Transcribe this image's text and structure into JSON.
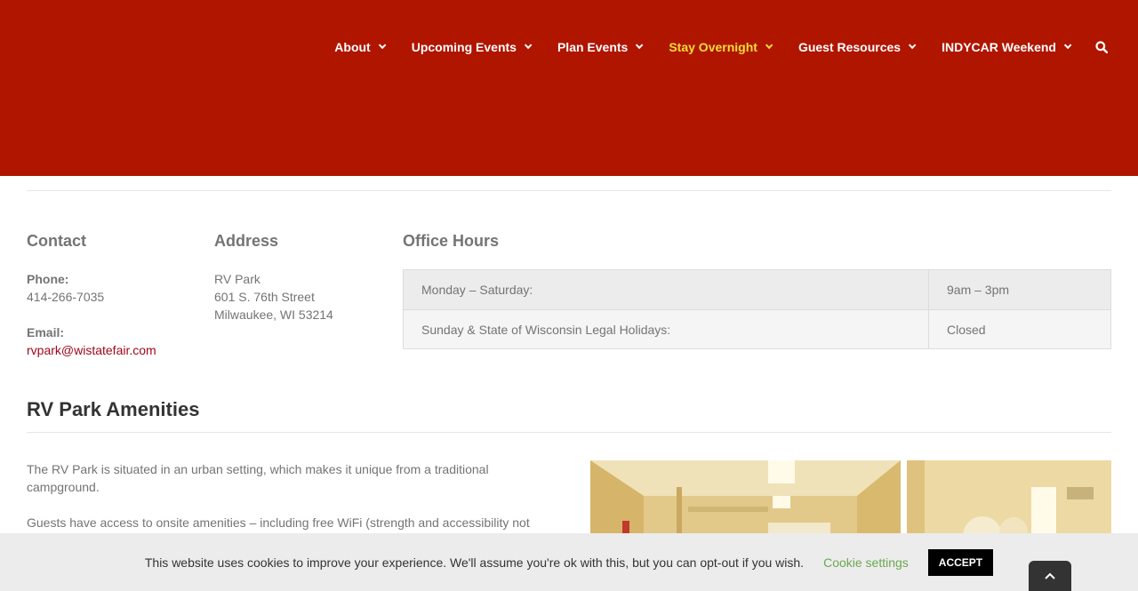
{
  "nav": {
    "items": [
      {
        "label": "About",
        "icon": "chevron-down-icon"
      },
      {
        "label": "Upcoming Events",
        "icon": "chevron-down-icon"
      },
      {
        "label": "Plan Events",
        "icon": "chevron-down-icon"
      },
      {
        "label": "Stay Overnight",
        "icon": "chevron-down-icon"
      },
      {
        "label": "Guest Resources",
        "icon": "chevron-down-icon"
      },
      {
        "label": "INDYCAR Weekend",
        "icon": "chevron-down-icon"
      }
    ],
    "active_item": "Stay Overnight",
    "search_icon": "search-icon"
  },
  "colors": {
    "header_bg": "#b01500",
    "nav_active": "#f6dd37",
    "link": "#a0071a",
    "cookie_settings": "#6aa84f"
  },
  "contact": {
    "title": "Contact",
    "phone_label": "Phone:",
    "phone": "414-266-7035",
    "email_label": "Email:",
    "email": "rvpark@wistatefair.com"
  },
  "address": {
    "title": "Address",
    "line1": "RV Park",
    "line2": "601 S. 76th Street",
    "line3": "Milwaukee, WI 53214"
  },
  "office_hours": {
    "title": "Office Hours",
    "rows": [
      {
        "days": "Monday – Saturday:",
        "hours": "9am – 3pm"
      },
      {
        "days": "Sunday & State of Wisconsin Legal Holidays:",
        "hours": "Closed"
      }
    ]
  },
  "amenities": {
    "title": "RV Park Amenities",
    "para1": "The RV Park is situated in an urban setting, which makes it unique from a traditional campground.",
    "para2": "Guests have access to onsite amenities – including free WiFi (strength and accessibility not"
  },
  "cookie": {
    "text": "This website uses cookies to improve your experience. We'll assume you're ok with this, but you can opt-out if you wish.",
    "settings_label": "Cookie settings",
    "accept_label": "ACCEPT"
  },
  "to_top_icon": "chevron-up-icon"
}
